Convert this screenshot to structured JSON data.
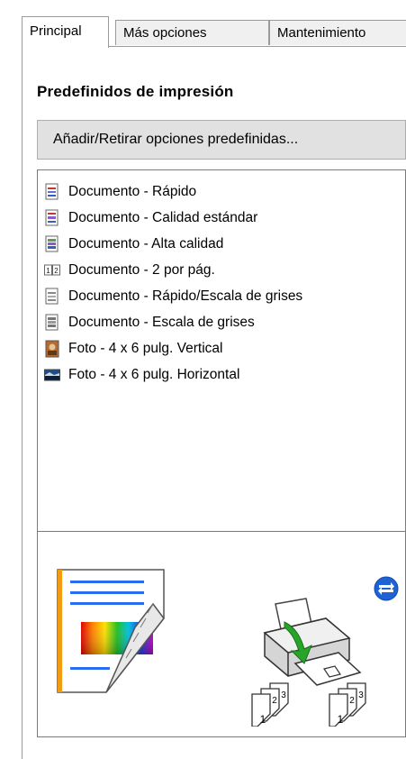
{
  "tabs": [
    {
      "label": "Principal",
      "active": true
    },
    {
      "label": "Más opciones",
      "active": false
    },
    {
      "label": "Mantenimiento",
      "active": false
    }
  ],
  "presets": {
    "title": "Predefinidos de impresión",
    "button_label": "Añadir/Retirar opciones predefinidas...",
    "items": [
      {
        "label": "Documento - Rápido",
        "icon": "document-fast-icon"
      },
      {
        "label": "Documento - Calidad estándar",
        "icon": "document-standard-icon"
      },
      {
        "label": "Documento - Alta calidad",
        "icon": "document-high-quality-icon"
      },
      {
        "label": "Documento - 2 por pág.",
        "icon": "two-per-page-icon"
      },
      {
        "label": "Documento - Rápido/Escala de grises",
        "icon": "document-fast-grayscale-icon"
      },
      {
        "label": "Documento - Escala de grises",
        "icon": "document-grayscale-icon"
      },
      {
        "label": "Foto - 4 x 6 pulg. Vertical",
        "icon": "photo-portrait-icon"
      },
      {
        "label": "Foto - 4 x 6 pulg. Horizontal",
        "icon": "photo-landscape-icon"
      }
    ]
  },
  "preview": {
    "collate_digits": [
      "1",
      "2",
      "3"
    ]
  }
}
